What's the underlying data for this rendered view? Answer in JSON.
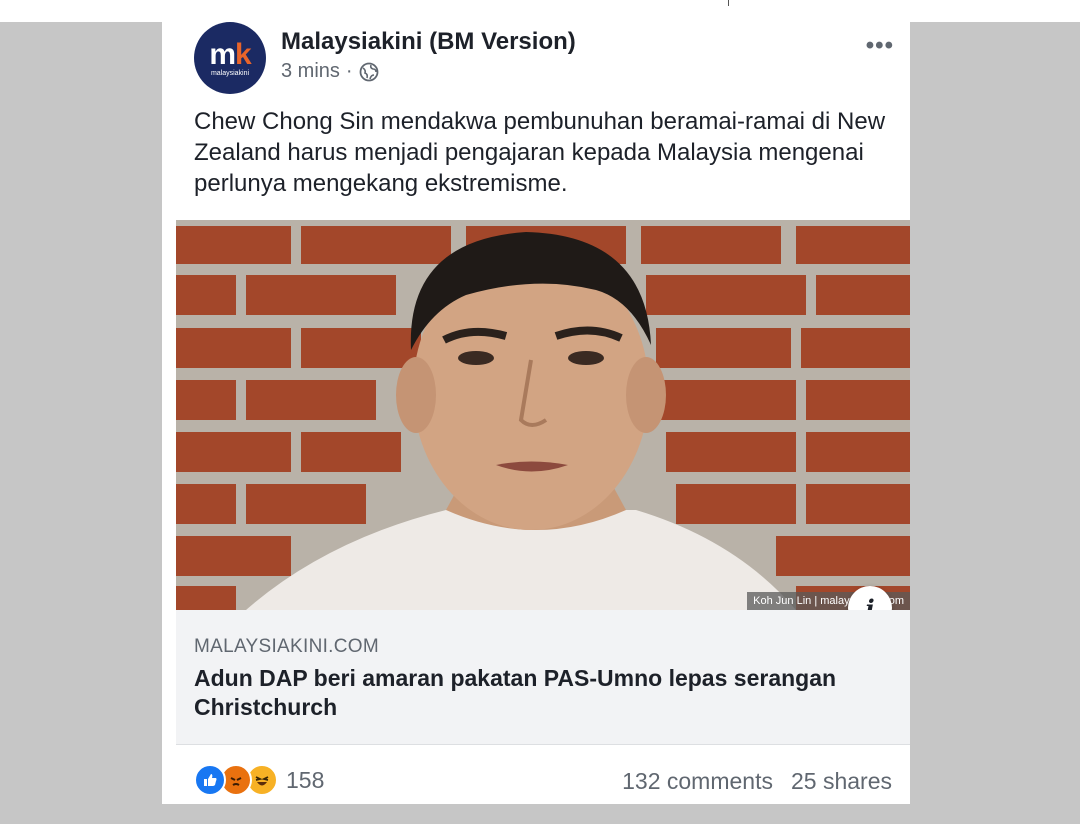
{
  "post": {
    "page_name": "Malaysiakini (BM Version)",
    "time": "3 mins",
    "separator": "·",
    "avatar_text": "mk",
    "avatar_sub": "malaysiakini",
    "more_label": "•••",
    "text": "Chew Chong Sin mendakwa pembunuhan beramai-ramai di New Zealand harus menjadi pengajaran kepada Malaysia mengenai perlunya mengekang ekstremisme."
  },
  "photo": {
    "credit": "Koh Jun Lin | malaysiakini.com",
    "info_label": "i"
  },
  "link": {
    "domain": "MALAYSIAKINI.COM",
    "title": "Adun DAP beri amaran pakatan PAS-Umno lepas serangan Christchurch"
  },
  "footer": {
    "reaction_icons": [
      "like-icon",
      "angry-icon",
      "haha-icon"
    ],
    "reaction_count": "158",
    "comments": "132 comments",
    "shares": "25 shares"
  },
  "colors": {
    "background": "#c6c6c6",
    "brand_navy": "#1b2a63",
    "brand_orange": "#e8642a",
    "like_blue": "#1877f2"
  }
}
